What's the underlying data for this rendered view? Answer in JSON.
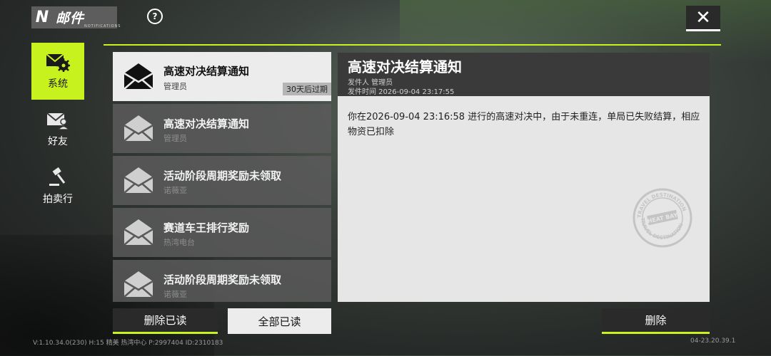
{
  "header": {
    "logo": "N",
    "title": "邮件",
    "title_sub": "NOTIFICATIONS",
    "help_icon": "?",
    "close_icon": "✕"
  },
  "sidebar": {
    "items": [
      {
        "label": "系统",
        "icon": "mail-gear-icon",
        "active": true
      },
      {
        "label": "好友",
        "icon": "mail-person-icon",
        "active": false
      },
      {
        "label": "拍卖行",
        "icon": "gavel-icon",
        "active": false
      }
    ]
  },
  "mail_list": [
    {
      "title": "高速对决结算通知",
      "sender": "管理员",
      "expire": "30天后过期",
      "active": true
    },
    {
      "title": "高速对决结算通知",
      "sender": "管理员",
      "active": false
    },
    {
      "title": "活动阶段周期奖励未领取",
      "sender": "诺薇亚",
      "active": false
    },
    {
      "title": "赛道车王排行奖励",
      "sender": "热湾电台",
      "active": false
    },
    {
      "title": "活动阶段周期奖励未领取",
      "sender": "诺薇亚",
      "active": false
    }
  ],
  "detail": {
    "title": "高速对决结算通知",
    "sender": "发件人  管理员",
    "time": "发件时间  2026-09-04 23:17:55",
    "body": "你在2026-09-04 23:16:58 进行的高速对决中，由于未重连，单局已失败结算，相应物资已扣除",
    "stamp_top": "TRAVEL DESTINATION",
    "stamp_mid": "HEAT BAY"
  },
  "buttons": {
    "delete_read": "删除已读",
    "mark_all_read": "全部已读",
    "delete": "删除"
  },
  "footer": {
    "left": "V:1.10.34.0(230) H:15 精美 热湾中心 P:2997404 ID:2310183",
    "right": "04-23.20.39.1"
  },
  "colors": {
    "accent": "#c9f31d"
  }
}
